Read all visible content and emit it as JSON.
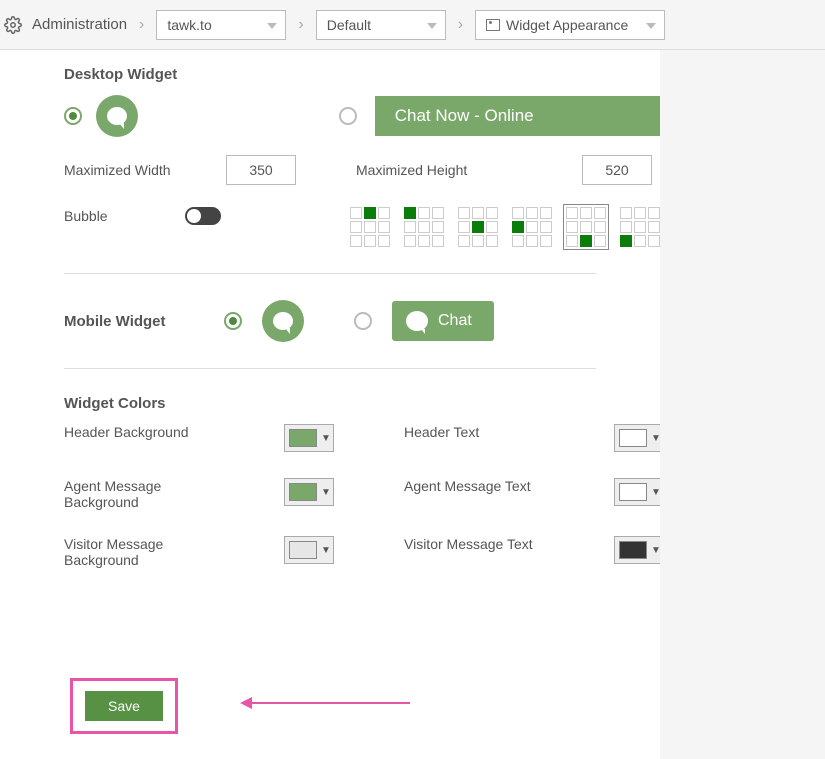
{
  "breadcrumb": {
    "root": "Administration",
    "site": "tawk.to",
    "widget": "Default",
    "page": "Widget Appearance"
  },
  "desktop": {
    "title": "Desktop Widget",
    "chat_now": "Chat Now - Online",
    "max_width_label": "Maximized Width",
    "max_width_value": "350",
    "max_height_label": "Maximized Height",
    "max_height_value": "520",
    "bubble_label": "Bubble",
    "bubble_toggle": false,
    "position_grids": [
      {
        "idx": 1,
        "selected": false
      },
      {
        "idx": 2,
        "selected": false
      },
      {
        "idx": 4,
        "selected": false
      },
      {
        "idx": 5,
        "selected": false
      },
      {
        "idx": 8,
        "selected": true
      },
      {
        "idx": 7,
        "selected": false
      }
    ]
  },
  "mobile": {
    "title": "Mobile Widget",
    "chat_label": "Chat"
  },
  "colors": {
    "title": "Widget Colors",
    "rows": [
      {
        "l_label": "Header Background",
        "l_color": "#7aa86a",
        "r_label": "Header Text",
        "r_color": "#ffffff"
      },
      {
        "l_label": "Agent Message Background",
        "l_color": "#7aa86a",
        "r_label": "Agent Message Text",
        "r_color": "#ffffff"
      },
      {
        "l_label": "Visitor Message Background",
        "l_color": "#e6e6e6",
        "r_label": "Visitor Message Text",
        "r_color": "#333333"
      }
    ]
  },
  "save": {
    "label": "Save"
  }
}
